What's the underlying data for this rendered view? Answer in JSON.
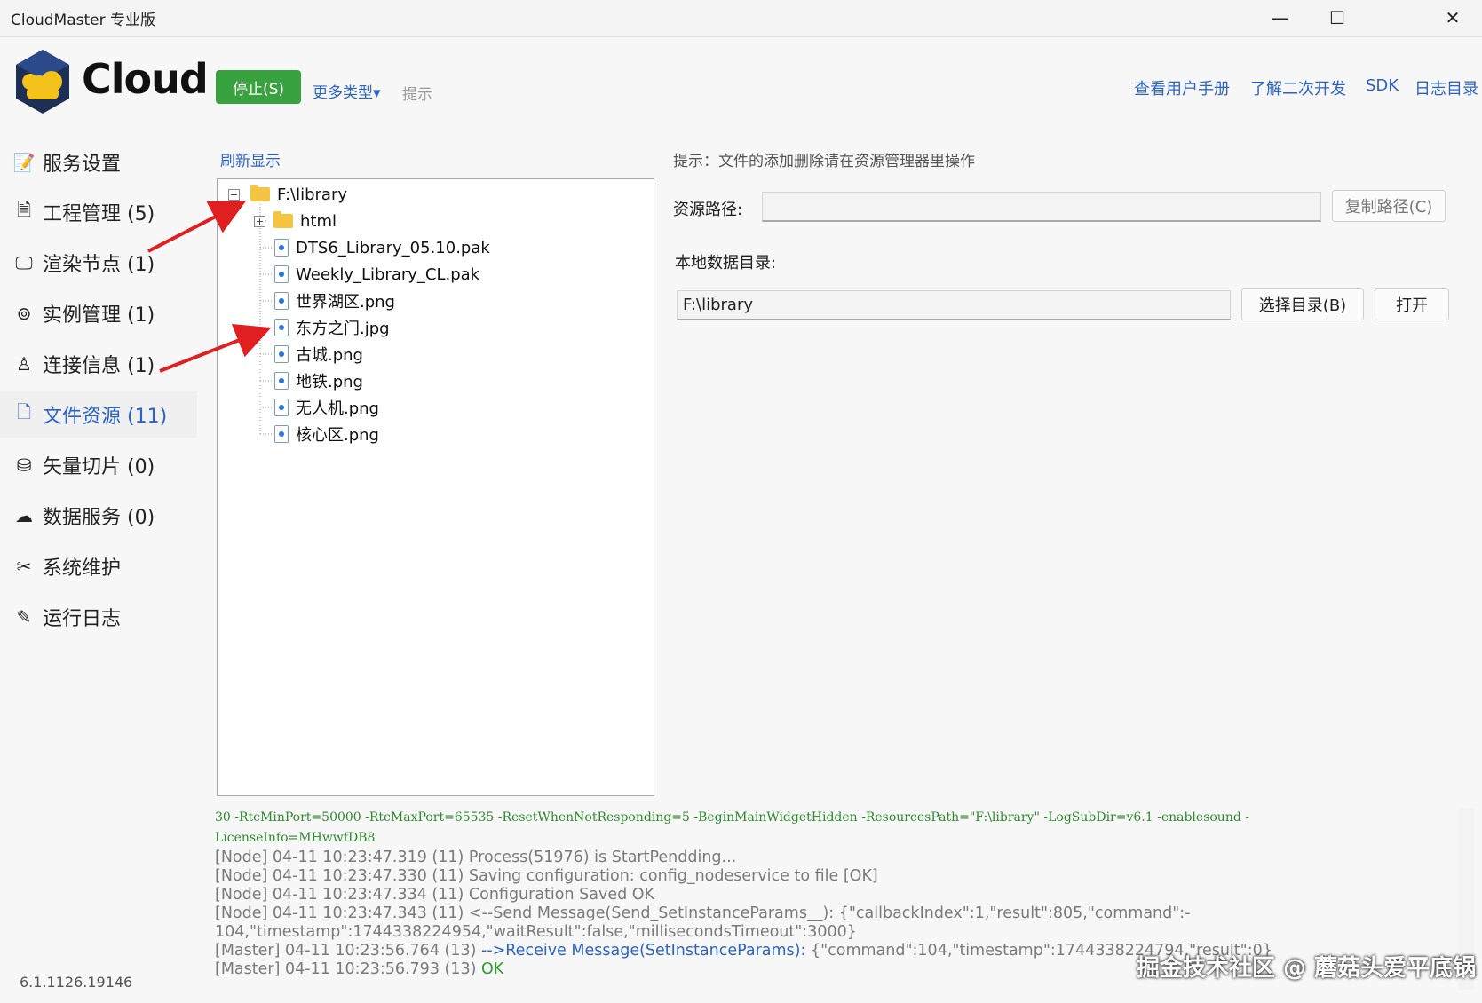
{
  "window": {
    "title": "CloudMaster 专业版",
    "minimize": "—",
    "maximize": "☐",
    "close": "✕"
  },
  "header": {
    "brand": "Cloud",
    "stop_button": "停止(S)",
    "more_types": "更多类型▾",
    "hint": "提示",
    "links": [
      "查看用户手册",
      "了解二次开发",
      "SDK",
      "日志目录"
    ]
  },
  "sidebar": {
    "items": [
      {
        "label": "服务设置",
        "icon": "settings-icon"
      },
      {
        "label": "工程管理 (5)",
        "icon": "document-icon"
      },
      {
        "label": "渲染节点 (1)",
        "icon": "monitor-icon"
      },
      {
        "label": "实例管理 (1)",
        "icon": "instance-icon"
      },
      {
        "label": "连接信息 (1)",
        "icon": "user-icon"
      },
      {
        "label": "文件资源 (11)",
        "icon": "file-icon"
      },
      {
        "label": "矢量切片 (0)",
        "icon": "database-icon"
      },
      {
        "label": "数据服务 (0)",
        "icon": "cloud-upload-icon"
      },
      {
        "label": "系统维护",
        "icon": "tools-icon"
      },
      {
        "label": "运行日志",
        "icon": "log-icon"
      }
    ],
    "active_index": 5,
    "version": "6.1.1126.19146"
  },
  "files": {
    "refresh": "刷新显示",
    "root": "F:\\library",
    "folder": "html",
    "items": [
      "DTS6_Library_05.10.pak",
      "Weekly_Library_CL.pak",
      "世界湖区.png",
      "东方之门.jpg",
      "古城.png",
      "地铁.png",
      "无人机.png",
      "核心区.png"
    ]
  },
  "details": {
    "tip": "提示：文件的添加删除请在资源管理器里操作",
    "resource_path_label": "资源路径:",
    "resource_path_value": "",
    "copy_path": "复制路径(C)",
    "local_dir_label": "本地数据目录:",
    "local_dir_value": "F:\\library",
    "choose_dir": "选择目录(B)",
    "open": "打开"
  },
  "log": {
    "cmd_line1": "30 -RtcMinPort=50000 -RtcMaxPort=65535 -ResetWhenNotResponding=5 -BeginMainWidgetHidden -ResourcesPath=\"F:\\library\" -LogSubDir=v6.1 -enablesound -",
    "cmd_line2": "LicenseInfo=MHwwfDB8",
    "line1": "[Node] 04-11 10:23:47.319 (11) Process(51976) is StartPendding...",
    "line2": "[Node] 04-11 10:23:47.330 (11) Saving configuration: config_nodeservice to file [OK]",
    "line3": "[Node] 04-11 10:23:47.334 (11) Configuration Saved OK",
    "line4": "[Node] 04-11 10:23:47.343 (11) <--Send Message(Send_SetInstanceParams__): {\"callbackIndex\":1,\"result\":805,\"command\":-",
    "line5": "104,\"timestamp\":1744338224954,\"waitResult\":false,\"millisecondsTimeout\":3000}",
    "line6_prefix": "[Master] 04-11 10:23:56.764 (13) ",
    "line6_blue": "-->Receive Message(SetInstanceParams):",
    "line6_rest": " {\"command\":104,\"timestamp\":1744338224794,\"result\":0}",
    "line7_prefix": "[Master] 04-11 10:23:56.793 (13) ",
    "line7_ok": "OK"
  },
  "watermark": "掘金技术社区 @ 蘑菇头爱平底锅",
  "colors": {
    "accent": "#2d63c6",
    "stop_green": "#38a23f",
    "log_green": "#2e8b2e",
    "arrow_red": "#e02020"
  }
}
